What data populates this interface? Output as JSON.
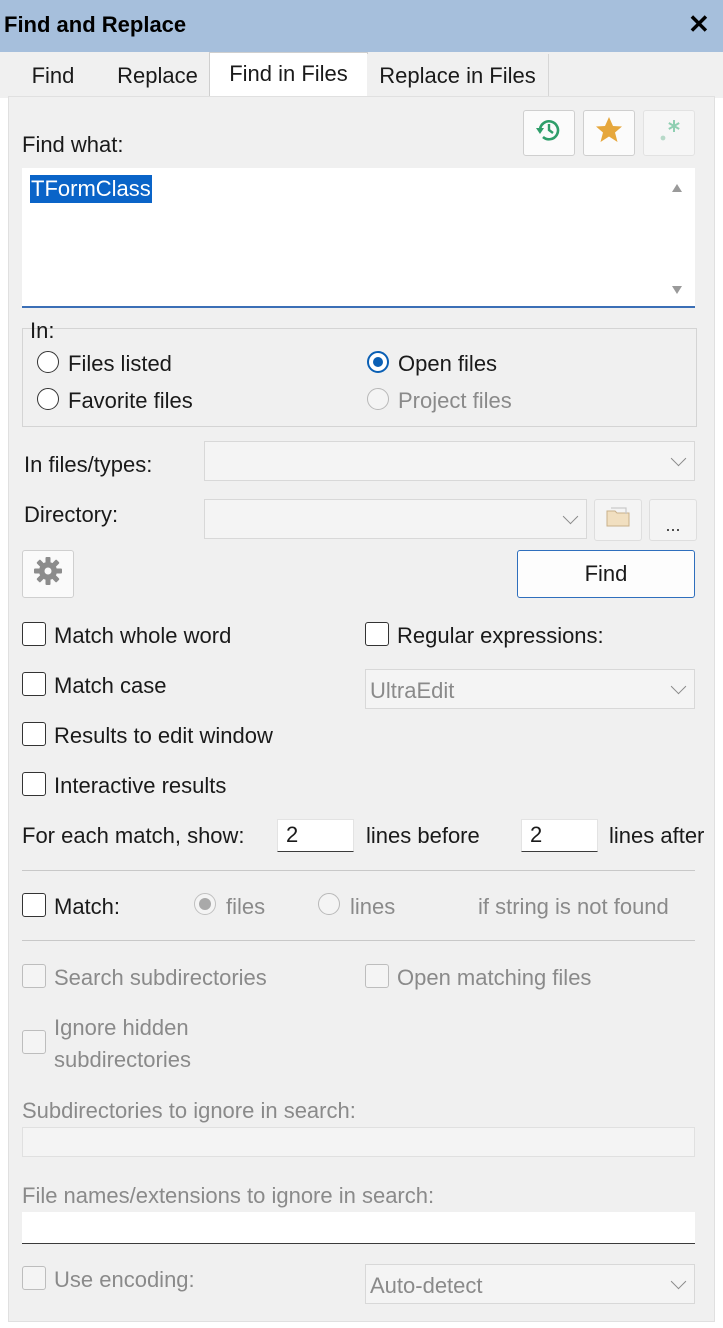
{
  "window": {
    "title": "Find and Replace",
    "close_label": "✕"
  },
  "tabs": [
    {
      "label": "Find"
    },
    {
      "label": "Replace"
    },
    {
      "label": "Find in Files"
    },
    {
      "label": "Replace in Files"
    }
  ],
  "find_what": {
    "label": "Find what:",
    "value": "TFormClass"
  },
  "in_group": {
    "label": "In:",
    "options": [
      {
        "label": "Files listed",
        "checked": false,
        "enabled": true
      },
      {
        "label": "Open files",
        "checked": true,
        "enabled": true
      },
      {
        "label": "Favorite files",
        "checked": false,
        "enabled": true
      },
      {
        "label": "Project files",
        "checked": false,
        "enabled": false
      }
    ]
  },
  "in_files_types": {
    "label": "In files/types:",
    "value": ""
  },
  "directory": {
    "label": "Directory:",
    "value": "",
    "browse_label": "..."
  },
  "find_button": {
    "label": "Find"
  },
  "options": {
    "match_whole_word": "Match whole word",
    "regular_expressions": "Regular expressions:",
    "match_case": "Match case",
    "regex_engine": "UltraEdit",
    "results_to_edit_window": "Results to edit window",
    "interactive_results": "Interactive results"
  },
  "context": {
    "label": "For each match, show:",
    "before_value": "2",
    "before_label": "lines before",
    "after_value": "2",
    "after_label": "lines after"
  },
  "match": {
    "label": "Match:",
    "files_label": "files",
    "lines_label": "lines",
    "not_found_label": "if string is not found"
  },
  "subdirs": {
    "search_subdirectories": "Search subdirectories",
    "open_matching_files": "Open matching files",
    "ignore_hidden_line1": "Ignore hidden",
    "ignore_hidden_line2": "subdirectories",
    "subdirs_ignore_label": "Subdirectories to ignore in search:",
    "filenames_ignore_label": "File names/extensions to ignore in search:"
  },
  "encoding": {
    "label": "Use encoding:",
    "value": "Auto-detect"
  }
}
